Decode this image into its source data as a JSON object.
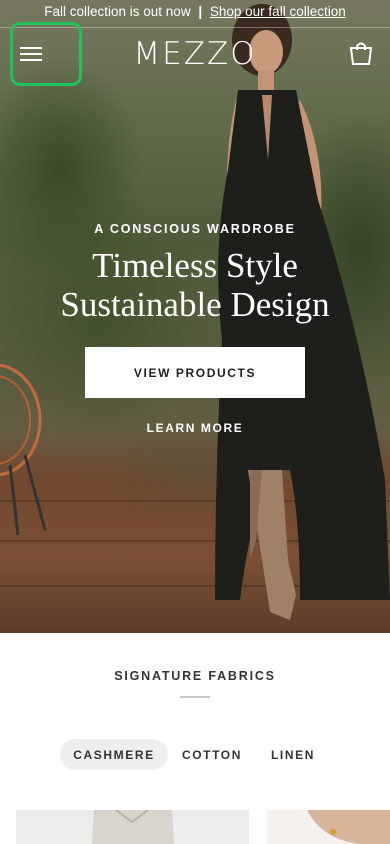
{
  "announcement": {
    "text": "Fall collection is out now",
    "separator": "|",
    "link": "Shop our fall collection"
  },
  "header": {
    "logo": "MEZZO",
    "menu_icon": "hamburger-menu-icon",
    "cart_icon": "shopping-bag-icon"
  },
  "hero": {
    "eyebrow": "A CONSCIOUS WARDROBE",
    "title_line1": "Timeless Style",
    "title_line2": "Sustainable Design",
    "primary_button": "VIEW PRODUCTS",
    "secondary_link": "LEARN MORE"
  },
  "fabrics": {
    "title": "SIGNATURE FABRICS",
    "tabs": [
      {
        "label": "CASHMERE",
        "active": true
      },
      {
        "label": "COTTON",
        "active": false
      },
      {
        "label": "LINEN",
        "active": false
      }
    ]
  },
  "colors": {
    "highlight": "#1fc35a",
    "text_dark": "#222222",
    "tab_active_bg": "#eeeeee"
  }
}
